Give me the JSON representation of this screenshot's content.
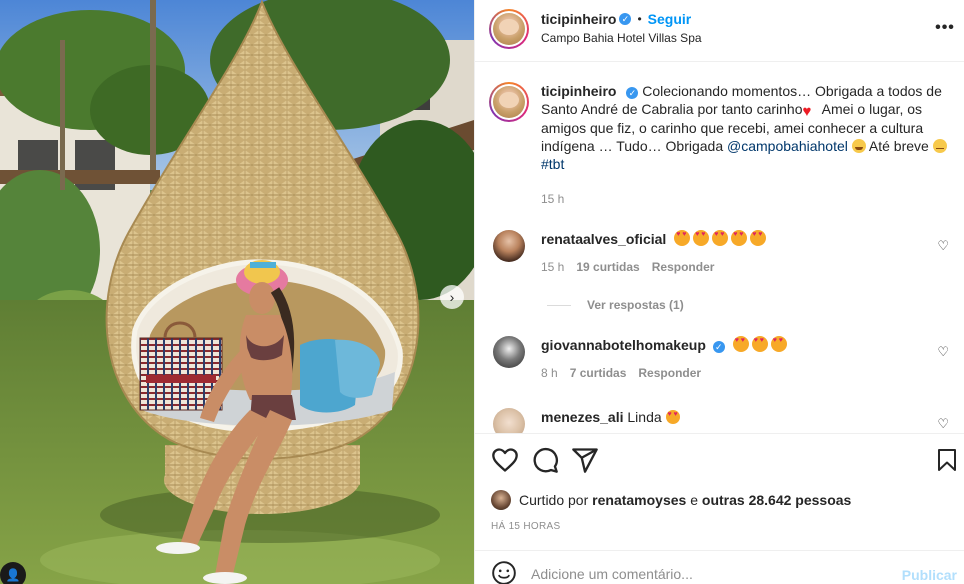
{
  "post": {
    "author": "ticipinheiro",
    "follow_label": "Seguir",
    "separator": "•",
    "location": "Campo Bahia Hotel Villas Spa",
    "more_icon": "more-horizontal-icon"
  },
  "caption": {
    "username": "ticipinheiro",
    "text_1": "Colecionando momentos… Obrigada a todos de Santo André de Cabralia por tanto carinho",
    "text_2": " Amei o lugar, os amigos que fiz, o carinho que recebi, amei conhecer a cultura indígena … Tudo… Obrigada ",
    "mention": "@campobahiahotel",
    "text_3": " Até breve ",
    "hashtag": "#tbt",
    "time": "15 h"
  },
  "comments": [
    {
      "username": "renataalves_oficial",
      "emoji_count": 5,
      "time": "15 h",
      "likes": "19 curtidas",
      "reply_label": "Responder",
      "replies_label": "Ver respostas (1)"
    },
    {
      "username": "giovannabotelhomakeup",
      "emoji_count": 3,
      "time": "8 h",
      "likes": "7 curtidas",
      "reply_label": "Responder"
    },
    {
      "username": "menezes_ali",
      "text": "Linda"
    }
  ],
  "likes_summary": {
    "prefix": "Curtido por",
    "user": "renatamoyses",
    "joiner": "e",
    "others": "outras 28.642 pessoas"
  },
  "time_ago": "HÁ 15 HORAS",
  "add_comment": {
    "placeholder": "Adicione um comentário...",
    "publish_label": "Publicar"
  },
  "colors": {
    "accent_blue": "#0095f6",
    "verified": "#3897f0",
    "muted": "#8e8e8e",
    "publish_disabled": "#b2dffc"
  }
}
